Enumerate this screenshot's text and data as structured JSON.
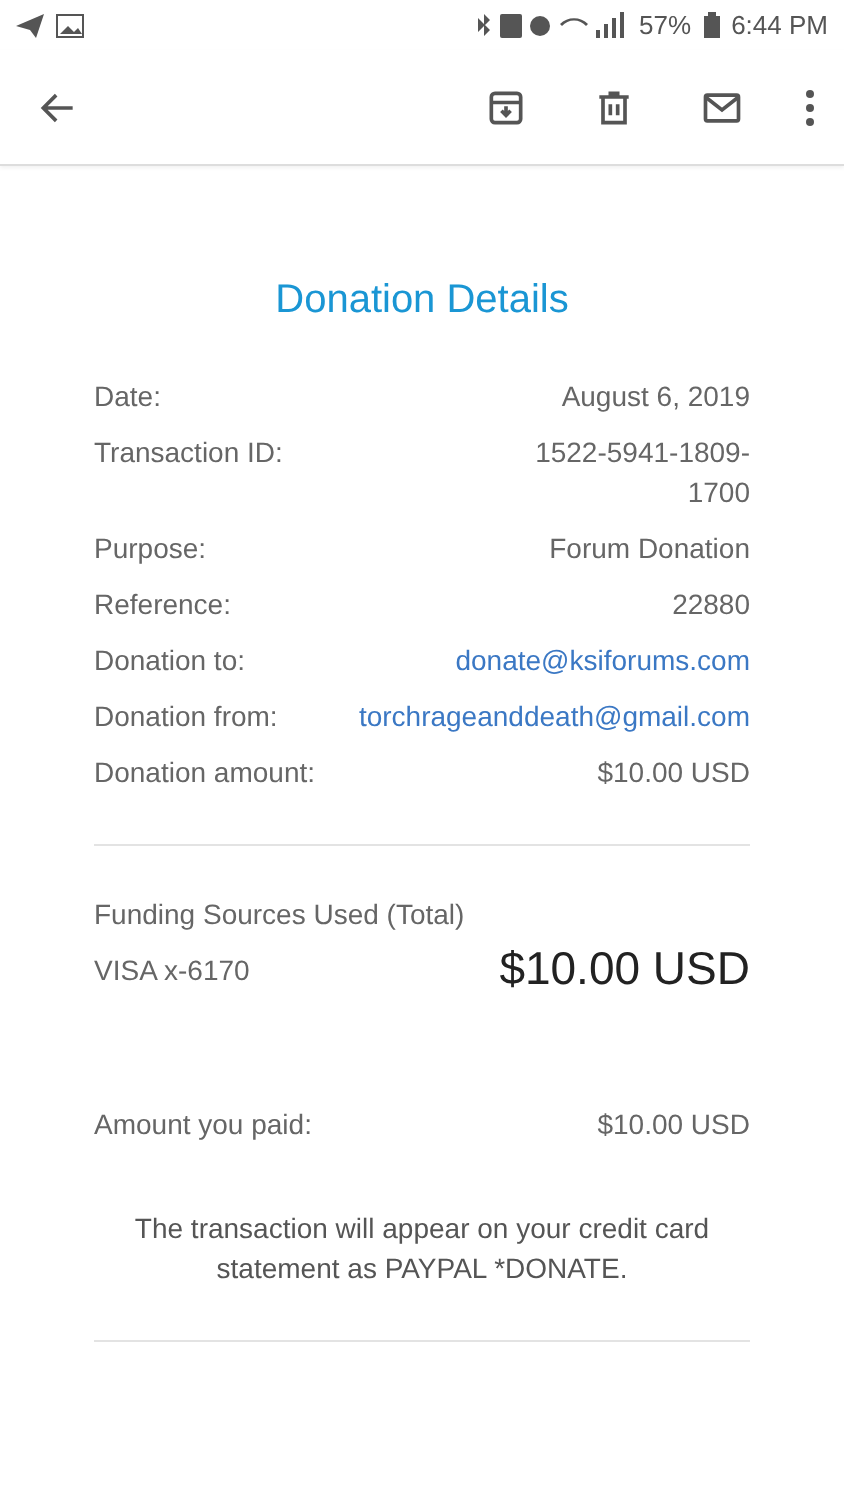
{
  "status_bar": {
    "battery": "57%",
    "time": "6:44 PM"
  },
  "toolbar": {
    "actions": [
      {
        "kind": "back"
      },
      {
        "kind": "archive"
      },
      {
        "kind": "delete"
      },
      {
        "kind": "mark-unread"
      },
      {
        "kind": "more"
      }
    ]
  },
  "title": "Donation Details",
  "details": [
    {
      "label": "Date:",
      "value": "August 6, 2019",
      "kind": "text"
    },
    {
      "label": "Transaction ID:",
      "value": "1522-5941-1809-1700",
      "kind": "text"
    },
    {
      "label": "Purpose:",
      "value": "Forum Donation",
      "kind": "text"
    },
    {
      "label": "Reference:",
      "value": "22880",
      "kind": "text"
    },
    {
      "label": "Donation to:",
      "value": "donate@ksiforums.com",
      "kind": "link"
    },
    {
      "label": "Donation from:",
      "value": "torchrageanddeath@gmail.com",
      "kind": "link"
    },
    {
      "label": "Donation amount:",
      "value": "$10.00 USD",
      "kind": "text"
    }
  ],
  "funding": {
    "heading": "Funding Sources Used (Total)",
    "source": "VISA x-6170",
    "amount": "$10.00 USD"
  },
  "paid": {
    "label": "Amount you paid:",
    "value": "$10.00 USD"
  },
  "note": "The transaction will appear on your credit card statement as PAYPAL *DONATE."
}
